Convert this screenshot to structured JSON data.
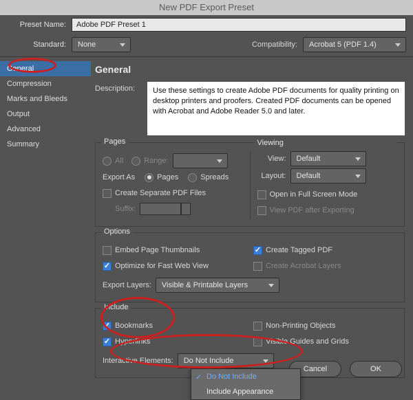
{
  "window": {
    "title": "New PDF Export Preset"
  },
  "header": {
    "preset_name_label": "Preset Name:",
    "preset_name_value": "Adobe PDF Preset 1",
    "standard_label": "Standard:",
    "standard_value": "None",
    "compatibility_label": "Compatibility:",
    "compatibility_value": "Acrobat 5 (PDF 1.4)"
  },
  "sidebar": {
    "items": [
      {
        "label": "General"
      },
      {
        "label": "Compression"
      },
      {
        "label": "Marks and Bleeds"
      },
      {
        "label": "Output"
      },
      {
        "label": "Advanced"
      },
      {
        "label": "Summary"
      }
    ]
  },
  "general": {
    "panel_title": "General",
    "description_label": "Description:",
    "description_text": "Use these settings to create Adobe PDF documents for quality printing on desktop printers and proofers.  Created PDF documents can be opened with Acrobat and Adobe Reader 5.0 and later.",
    "pages": {
      "title": "Pages",
      "all": "All",
      "range": "Range:",
      "export_as": "Export As",
      "pages_opt": "Pages",
      "spreads_opt": "Spreads",
      "create_separate": "Create Separate PDF Files",
      "suffix": "Suffix:"
    },
    "viewing": {
      "title": "Viewing",
      "view_label": "View:",
      "view_value": "Default",
      "layout_label": "Layout:",
      "layout_value": "Default",
      "open_full_screen": "Open in Full Screen Mode",
      "view_after_export": "View PDF after Exporting"
    },
    "options": {
      "title": "Options",
      "embed_thumbs": "Embed Page Thumbnails",
      "optimize": "Optimize for Fast Web View",
      "create_tagged": "Create Tagged PDF",
      "acrobat_layers": "Create Acrobat Layers",
      "export_layers_label": "Export Layers:",
      "export_layers_value": "Visible & Printable Layers"
    },
    "include": {
      "title": "Include",
      "bookmarks": "Bookmarks",
      "hyperlinks": "Hyperlinks",
      "non_printing": "Non-Printing Objects",
      "visible_guides": "Visible Guides and Grids",
      "interactive_label": "Interactive Elements:",
      "interactive_value": "Do Not Include",
      "dd_opt1": "Do Not Include",
      "dd_opt2": "Include Appearance"
    }
  },
  "buttons": {
    "cancel": "Cancel",
    "ok": "OK"
  }
}
